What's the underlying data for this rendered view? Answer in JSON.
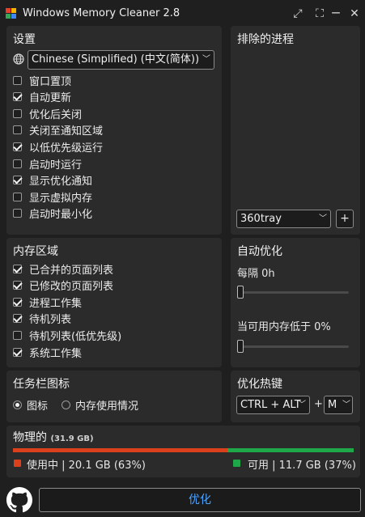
{
  "window": {
    "title": "Windows Memory Cleaner 2.8",
    "icon_colors": [
      "#e8402c",
      "#f4b400",
      "#34a853",
      "#4285f4"
    ]
  },
  "settings": {
    "heading": "设置",
    "language": "Chinese (Simplified) (中文(简体))",
    "options": [
      {
        "label": "窗口置顶",
        "checked": false
      },
      {
        "label": "自动更新",
        "checked": true
      },
      {
        "label": "优化后关闭",
        "checked": false
      },
      {
        "label": "关闭至通知区域",
        "checked": false
      },
      {
        "label": "以低优先级运行",
        "checked": true
      },
      {
        "label": "启动时运行",
        "checked": false
      },
      {
        "label": "显示优化通知",
        "checked": true
      },
      {
        "label": "显示虚拟内存",
        "checked": false
      },
      {
        "label": "启动时最小化",
        "checked": false
      }
    ]
  },
  "excluded": {
    "heading": "排除的进程",
    "selected_process": "360tray",
    "add_label": "+"
  },
  "memory_areas": {
    "heading": "内存区域",
    "options": [
      {
        "label": "已合并的页面列表",
        "checked": true
      },
      {
        "label": "已修改的页面列表",
        "checked": true
      },
      {
        "label": "进程工作集",
        "checked": true
      },
      {
        "label": "待机列表",
        "checked": true
      },
      {
        "label": "待机列表(低优先级)",
        "checked": false
      },
      {
        "label": "系统工作集",
        "checked": true
      }
    ]
  },
  "auto_optimize": {
    "heading": "自动优化",
    "every_label": "每隔 0h",
    "every_value": 0,
    "below_label": "当可用内存低于 0%",
    "below_value": 0
  },
  "tray_icon": {
    "heading": "任务栏图标",
    "options": [
      {
        "label": "图标",
        "checked": true
      },
      {
        "label": "内存使用情况",
        "checked": false
      }
    ]
  },
  "hotkey": {
    "heading": "优化热键",
    "modifier": "CTRL + ALT",
    "plus": "+",
    "key": "M"
  },
  "physical": {
    "heading": "物理的",
    "total": "(31.9 GB)",
    "used_label": "使用中 | 20.1 GB (63%)",
    "free_label": "可用 | 11.7 GB (37%)",
    "used_percent": 63,
    "used_color": "#d9401b",
    "free_color": "#1fa84a"
  },
  "optimize_button": "优化",
  "accent_color": "#4aa3ff"
}
